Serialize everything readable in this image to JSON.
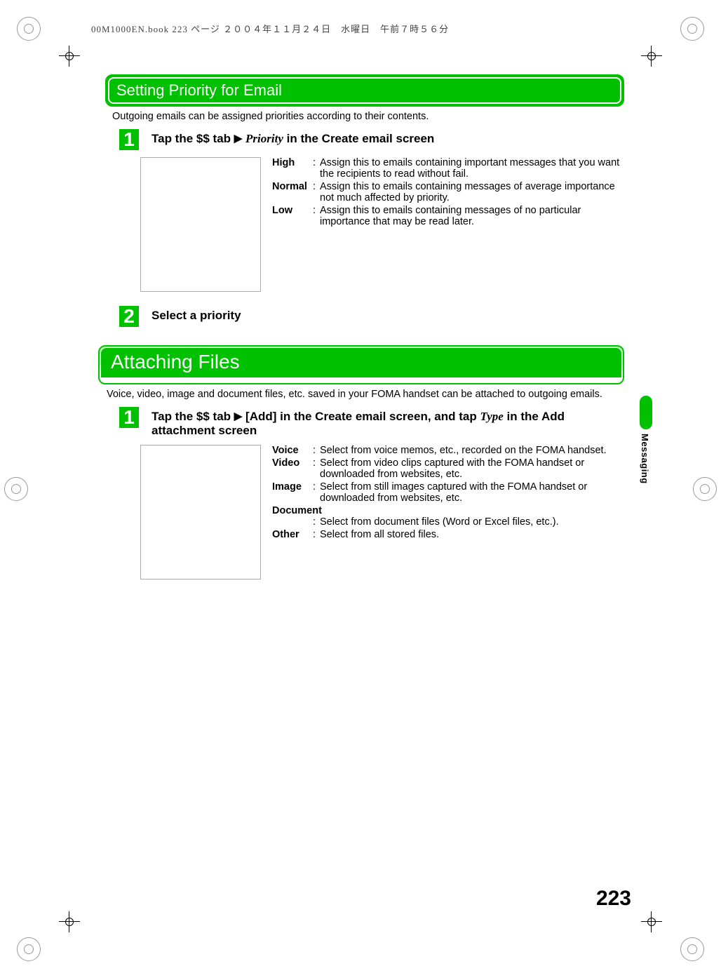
{
  "meta_header": "00M1000EN.book  223 ページ  ２００４年１１月２４日　水曜日　午前７時５６分",
  "section1": {
    "title": "Setting Priority for Email",
    "desc": "Outgoing emails can be assigned priorities according to their contents.",
    "step1_prefix": "Tap the $$ tab ",
    "step1_priority": "Priority",
    "step1_suffix": " in the Create email screen",
    "defs": [
      {
        "term": "High",
        "desc": "Assign this to emails containing important messages that you want the recipients to read without fail."
      },
      {
        "term": "Normal",
        "desc": "Assign this to emails containing messages of average importance not much affected by priority."
      },
      {
        "term": "Low",
        "desc": "Assign this to emails containing messages of no particular importance that may be read later."
      }
    ],
    "step2": "Select a priority"
  },
  "section2": {
    "title": "Attaching Files",
    "desc": "Voice, video, image and document files, etc. saved in your FOMA handset can be attached to outgoing emails.",
    "step1_a": "Tap the $$ tab ",
    "step1_b": " [Add] in the Create email screen, and tap ",
    "step1_type": "Type",
    "step1_c": " in the Add attachment screen",
    "defs": [
      {
        "term": "Voice",
        "desc": "Select from voice memos, etc., recorded on the FOMA handset."
      },
      {
        "term": "Video",
        "desc": "Select from video clips captured with the FOMA handset or downloaded from websites, etc."
      },
      {
        "term": "Image",
        "desc": "Select from still images captured with the FOMA handset or downloaded from websites, etc."
      },
      {
        "term": "Document",
        "desc": "Select from document files (Word or Excel files, etc.)."
      },
      {
        "term": "Other",
        "desc": "Select from all stored files."
      }
    ]
  },
  "side_tab": "Messaging",
  "page_number": "223",
  "nums": {
    "one": "1",
    "two": "2"
  }
}
